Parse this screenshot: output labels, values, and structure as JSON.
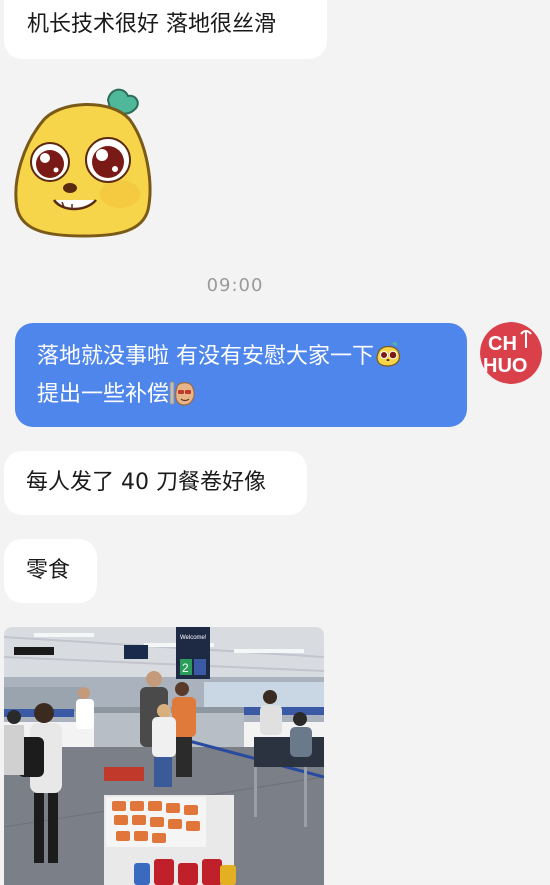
{
  "messages": {
    "msg1": "机长技术很好 落地很丝滑",
    "timestamp": "09:00",
    "self_line1": "落地就没事啦 有没有安慰大家一下",
    "self_line2": "提出一些补偿",
    "msg3": "每人发了 40 刀餐卷好像",
    "msg4": "零食"
  },
  "avatar": {
    "text_top": "CH",
    "text_bottom": "HUO",
    "color": "#d9404a"
  },
  "photo": {
    "sign_welcome": "Welcome!",
    "gate_number": "2"
  },
  "colors": {
    "self_bubble": "#4f86ec",
    "other_bubble": "#ffffff",
    "background": "#f3f3f3"
  }
}
